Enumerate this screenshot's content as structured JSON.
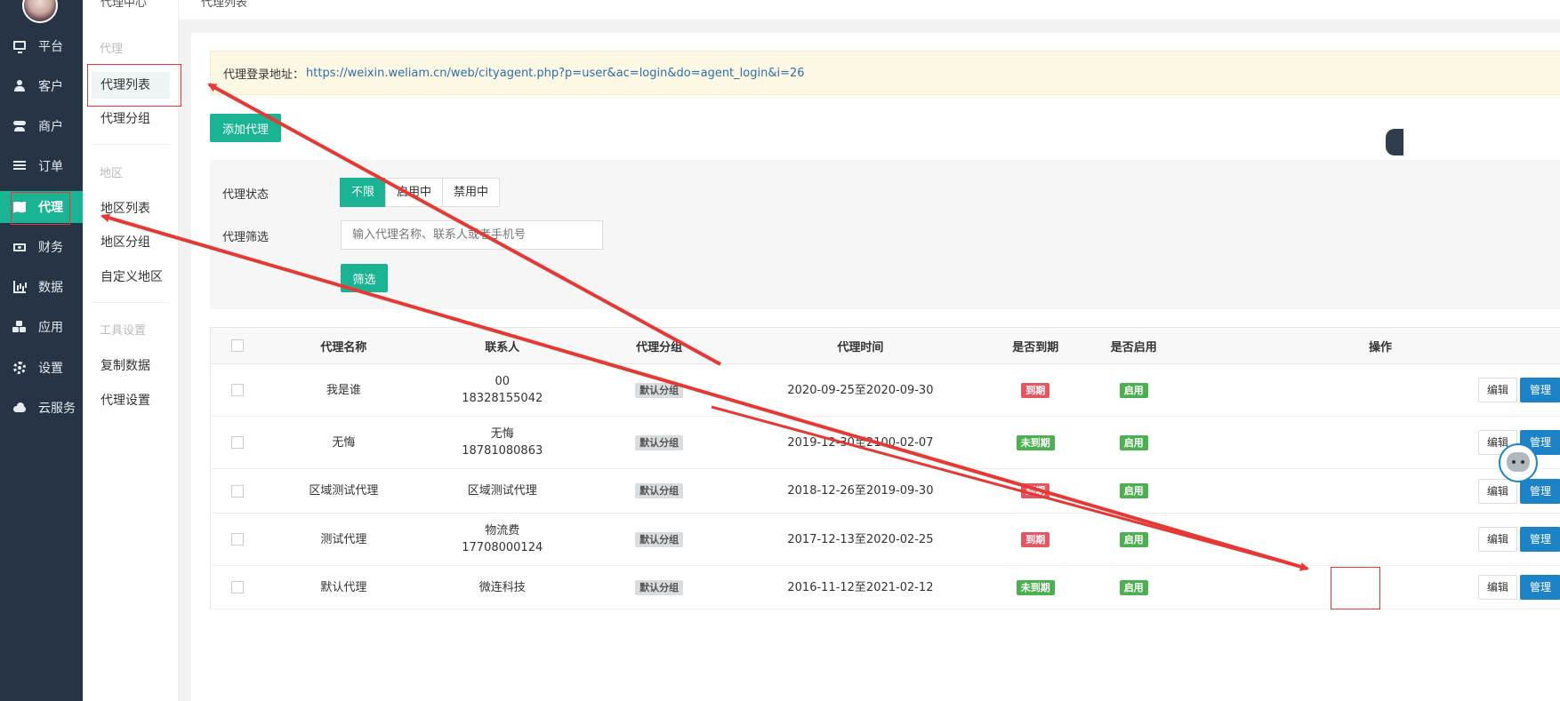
{
  "sidebar": {
    "items": [
      {
        "label": "平台",
        "icon": "monitor-icon"
      },
      {
        "label": "客户",
        "icon": "user-icon"
      },
      {
        "label": "商户",
        "icon": "users-icon"
      },
      {
        "label": "订单",
        "icon": "list-icon"
      },
      {
        "label": "代理",
        "icon": "map-icon",
        "active": true
      },
      {
        "label": "财务",
        "icon": "money-icon"
      },
      {
        "label": "数据",
        "icon": "bar-chart-icon"
      },
      {
        "label": "应用",
        "icon": "cubes-icon"
      },
      {
        "label": "设置",
        "icon": "gear-icon"
      },
      {
        "label": "云服务",
        "icon": "cloud-icon"
      }
    ]
  },
  "breadcrumb": {
    "first": "代理中心",
    "second": "代理列表"
  },
  "submenu": {
    "group_agent": "代理",
    "agent_list": "代理列表",
    "agent_group": "代理分组",
    "group_region": "地区",
    "region_list": "地区列表",
    "region_group": "地区分组",
    "custom_region": "自定义地区",
    "group_tools": "工具设置",
    "copy_data": "复制数据",
    "agent_settings": "代理设置"
  },
  "notice": {
    "label": "代理登录地址：",
    "url": "https://weixin.weliam.cn/web/cityagent.php?p=user&ac=login&do=agent_login&i=26"
  },
  "add_agent_button": "添加代理",
  "filter": {
    "status_label": "代理状态",
    "status_options": [
      "不限",
      "启用中",
      "禁用中"
    ],
    "selected_status": "不限",
    "search_label": "代理筛选",
    "search_placeholder": "输入代理名称、联系人或者手机号",
    "search_value": "",
    "submit_label": "筛选"
  },
  "table": {
    "headers": [
      "代理名称",
      "联系人",
      "代理分组",
      "代理时间",
      "是否到期",
      "是否启用",
      "操作"
    ],
    "edit_label": "编辑",
    "manage_label": "管理",
    "rows": [
      {
        "name": "我是谁",
        "contact": "00",
        "phone": "18328155042",
        "group": "默认分组",
        "time": "2020-09-25至2020-09-30",
        "expired": "到期",
        "expired_color": "#e25763",
        "enabled": "启用"
      },
      {
        "name": "无悔",
        "contact": "无悔",
        "phone": "18781080863",
        "group": "默认分组",
        "time": "2019-12-30至2100-02-07",
        "expired": "未到期",
        "expired_color": "#4caf50",
        "enabled": "启用"
      },
      {
        "name": "区域测试代理",
        "contact": "区域测试代理",
        "phone": "",
        "group": "默认分组",
        "time": "2018-12-26至2019-09-30",
        "expired": "到期",
        "expired_color": "#e25763",
        "enabled": "启用"
      },
      {
        "name": "测试代理",
        "contact": "物流费",
        "phone": "17708000124",
        "group": "默认分组",
        "time": "2017-12-13至2020-02-25",
        "expired": "到期",
        "expired_color": "#e25763",
        "enabled": "启用"
      },
      {
        "name": "默认代理",
        "contact": "微连科技",
        "phone": "",
        "group": "默认分组",
        "time": "2016-11-12至2021-02-12",
        "expired": "未到期",
        "expired_color": "#4caf50",
        "enabled": "启用"
      }
    ]
  },
  "colors": {
    "accent": "#1ab394",
    "sidebar_bg": "#263445",
    "manage_button": "#1c84c6",
    "annotation_red": "#e53935"
  }
}
